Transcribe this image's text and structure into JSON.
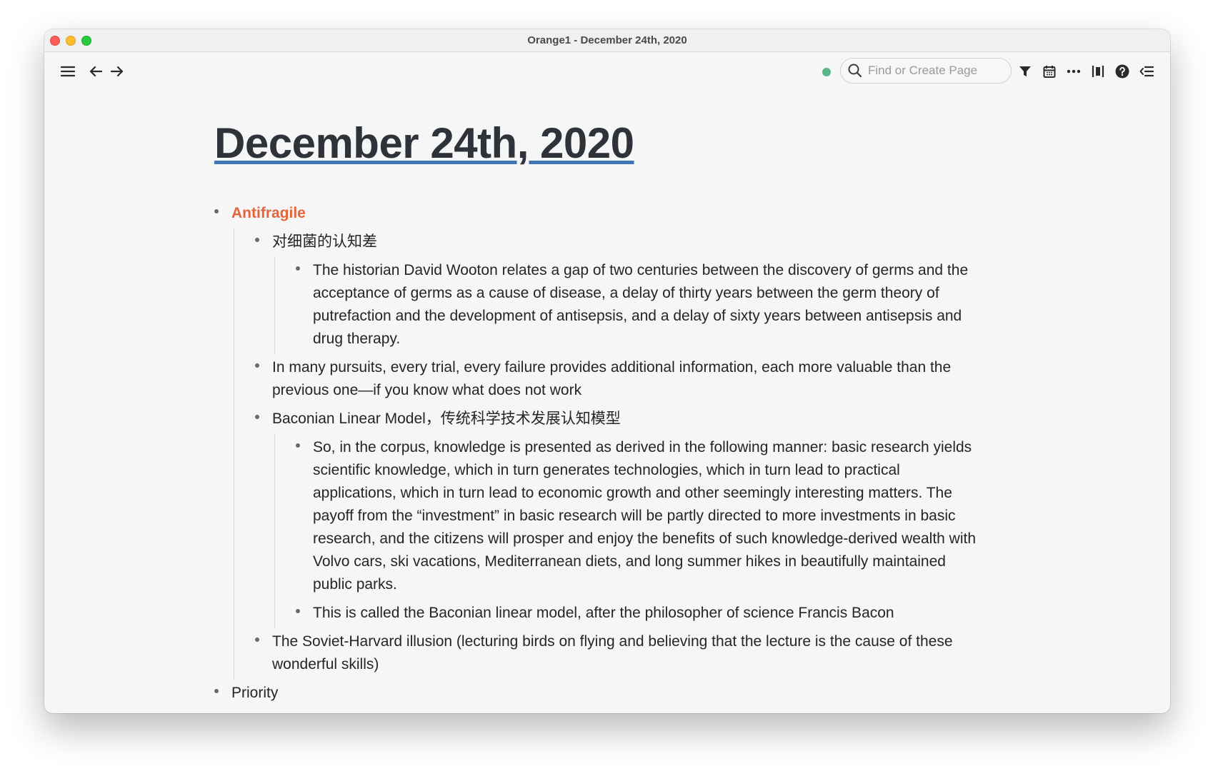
{
  "window": {
    "title": "Orange1 - December 24th, 2020"
  },
  "toolbar": {
    "search_placeholder": "Find or Create Page",
    "sync_status_color": "#5cb589"
  },
  "page": {
    "title": "December 24th, 2020",
    "blocks": [
      {
        "text": "Antifragile",
        "children": [
          {
            "text": "对细菌的认知差",
            "children": [
              {
                "text": "The historian David Wooton relates a gap of two centuries between the discovery of germs and the acceptance of germs as a cause of disease, a delay of thirty years between the germ theory of putrefaction and the development of antisepsis, and a delay of sixty years between antisepsis and drug therapy."
              }
            ]
          },
          {
            "text": "In many pursuits, every trial, every failure provides additional information, each more valuable than the previous one—if you know what does not work"
          },
          {
            "text": "Baconian Linear Model，传统科学技术发展认知模型",
            "children": [
              {
                "text": "So, in the corpus, knowledge is presented as derived in the following manner: basic research yields scientific knowledge, which in turn generates technologies, which in turn lead to practical applications, which in turn lead to economic growth and other seemingly interesting matters. The payoff from the “investment” in basic research will be partly directed to more investments in basic research, and the citizens will prosper and enjoy the benefits of such knowledge-derived wealth with Volvo cars, ski vacations, Mediterranean diets, and long summer hikes in beautifully maintained public parks."
              },
              {
                "text": "This is called the Baconian linear model, after the philosopher of science Francis Bacon"
              }
            ]
          },
          {
            "text": "The Soviet-Harvard illusion (lecturing birds on flying and believing that the lecture is the cause of these wonderful skills)"
          }
        ]
      },
      {
        "text": "Priority"
      }
    ]
  },
  "colors": {
    "link": "#e4643c",
    "title_underline": "#3e76b3"
  }
}
